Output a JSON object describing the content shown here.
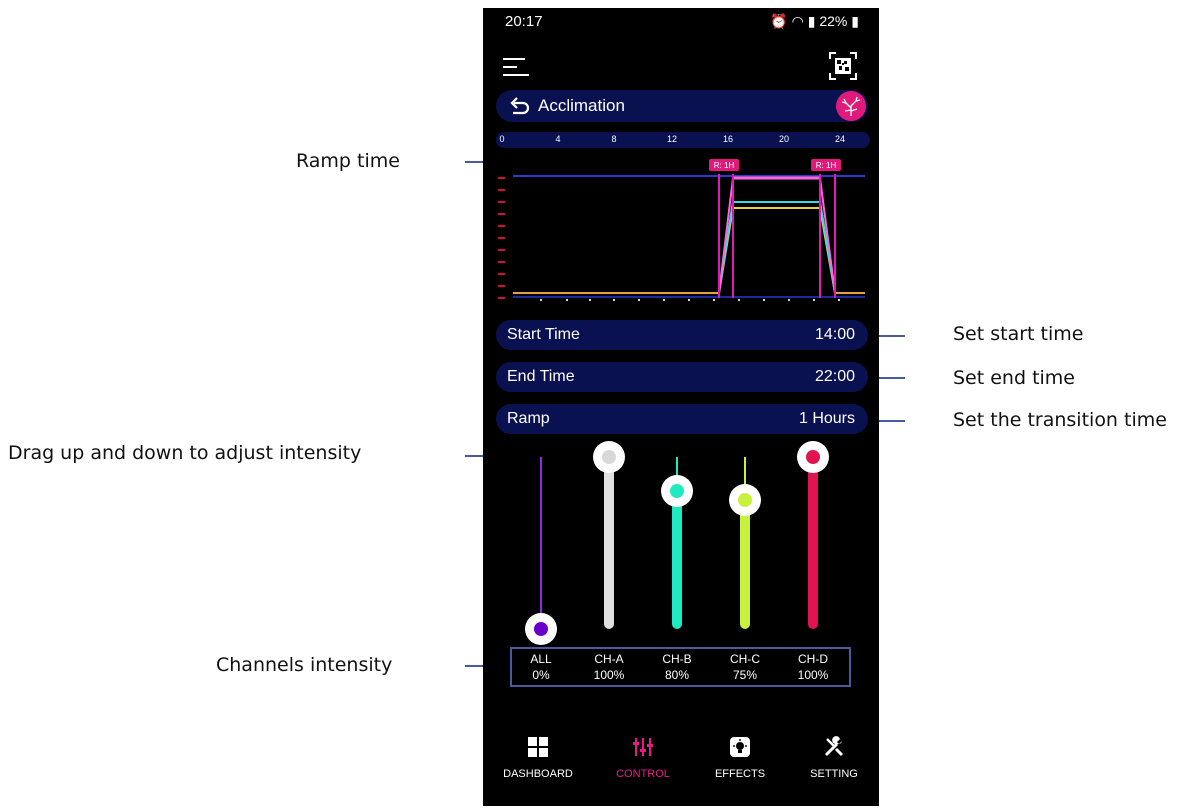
{
  "annotations": {
    "ramp_time": "Ramp time",
    "set_start_time": "Set start time",
    "set_end_time": "Set end time",
    "set_transition_time": "Set the transition time",
    "drag_intensity": "Drag up and down to adjust intensity",
    "channels_intensity": "Channels intensity"
  },
  "status_bar": {
    "time": "20:17",
    "battery": "22%"
  },
  "header": {
    "title": "Acclimation",
    "menu_icon": "hamburger-menu-icon",
    "qr_icon": "qr-code-icon"
  },
  "timeline": {
    "ticks": [
      "0",
      "4",
      "8",
      "12",
      "16",
      "20",
      "24"
    ],
    "ramp_markers": [
      "R: 1H",
      "R: 1H"
    ]
  },
  "settings": {
    "start_time": {
      "label": "Start Time",
      "value": "14:00"
    },
    "end_time": {
      "label": "End Time",
      "value": "22:00"
    },
    "ramp": {
      "label": "Ramp",
      "value": "1 Hours"
    }
  },
  "channels": [
    {
      "name": "ALL",
      "value": "0%",
      "level": 0.0,
      "color": "#6a00c8",
      "track": "#8a2be2"
    },
    {
      "name": "CH-A",
      "value": "100%",
      "level": 1.0,
      "color": "#d8d8d8",
      "track": "#e0e0e0"
    },
    {
      "name": "CH-B",
      "value": "80%",
      "level": 0.8,
      "color": "#20e8c0",
      "track": "#20e8c0"
    },
    {
      "name": "CH-C",
      "value": "75%",
      "level": 0.75,
      "color": "#c8f03c",
      "track": "#c8f03c"
    },
    {
      "name": "CH-D",
      "value": "100%",
      "level": 1.0,
      "color": "#e01450",
      "track": "#e01450"
    }
  ],
  "bottom_nav": [
    {
      "label": "DASHBOARD",
      "icon": "dashboard-grid-icon",
      "active": false
    },
    {
      "label": "CONTROL",
      "icon": "sliders-icon",
      "active": true
    },
    {
      "label": "EFFECTS",
      "icon": "effects-bulb-icon",
      "active": false
    },
    {
      "label": "SETTING",
      "icon": "tools-icon",
      "active": false
    }
  ],
  "colors": {
    "accent": "#e8178a",
    "pill_bg": "#0a1150",
    "annotation_line": "#4a5aa0"
  }
}
